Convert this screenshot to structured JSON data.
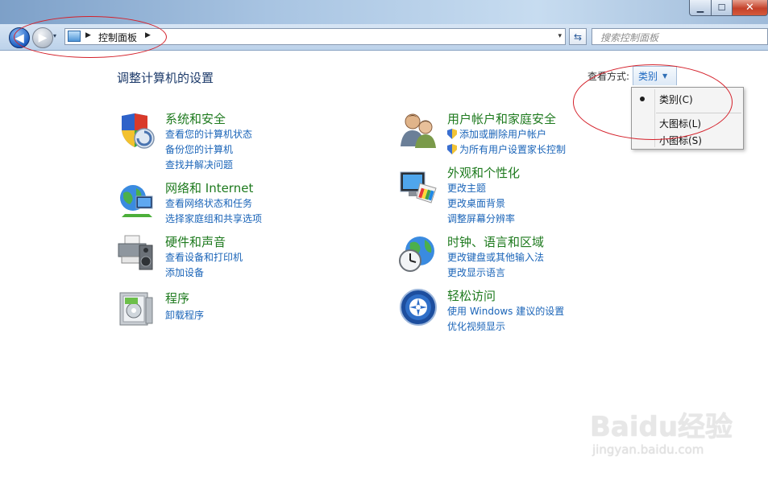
{
  "window": {
    "min_glyph": "▁",
    "max_glyph": "☐",
    "close_glyph": "✕"
  },
  "navbar": {
    "back_glyph": "◀",
    "fwd_glyph": "▶",
    "history_glyph": "▾",
    "breadcrumb": "控制面板",
    "address_dropdown_glyph": "▾",
    "refresh_glyph": "⇆",
    "search_placeholder": "搜索控制面板"
  },
  "header": {
    "title": "调整计算机的设置",
    "view_by_label": "查看方式:",
    "view_by_value": "类别"
  },
  "view_menu": {
    "items": [
      {
        "label": "类别(C)",
        "selected": true
      },
      {
        "label": "大图标(L)",
        "selected": false
      },
      {
        "label": "小图标(S)",
        "selected": false
      }
    ]
  },
  "categories_left": [
    {
      "title": "系统和安全",
      "icon": "shield-pc-icon",
      "links": [
        "查看您的计算机状态",
        "备份您的计算机",
        "查找并解决问题"
      ]
    },
    {
      "title": "网络和 Internet",
      "icon": "globe-network-icon",
      "links": [
        "查看网络状态和任务",
        "选择家庭组和共享选项"
      ]
    },
    {
      "title": "硬件和声音",
      "icon": "printer-speaker-icon",
      "links": [
        "查看设备和打印机",
        "添加设备"
      ]
    },
    {
      "title": "程序",
      "icon": "program-box-icon",
      "links": [
        "卸载程序"
      ]
    }
  ],
  "categories_right": [
    {
      "title": "用户帐户和家庭安全",
      "icon": "users-icon",
      "links": [
        "添加或删除用户帐户",
        "为所有用户设置家长控制"
      ]
    },
    {
      "title": "外观和个性化",
      "icon": "monitor-palette-icon",
      "links": [
        "更改主题",
        "更改桌面背景",
        "调整屏幕分辨率"
      ]
    },
    {
      "title": "时钟、语言和区域",
      "icon": "globe-clock-icon",
      "links": [
        "更改键盘或其他输入法",
        "更改显示语言"
      ]
    },
    {
      "title": "轻松访问",
      "icon": "ease-of-access-icon",
      "links": [
        "使用 Windows 建议的设置",
        "优化视频显示"
      ]
    }
  ],
  "watermark": {
    "brand": "Baidu经验",
    "url": "jingyan.baidu.com"
  },
  "colors": {
    "category_title": "#1e7a1e",
    "link": "#1a64b8",
    "annotation": "#d4202a"
  }
}
